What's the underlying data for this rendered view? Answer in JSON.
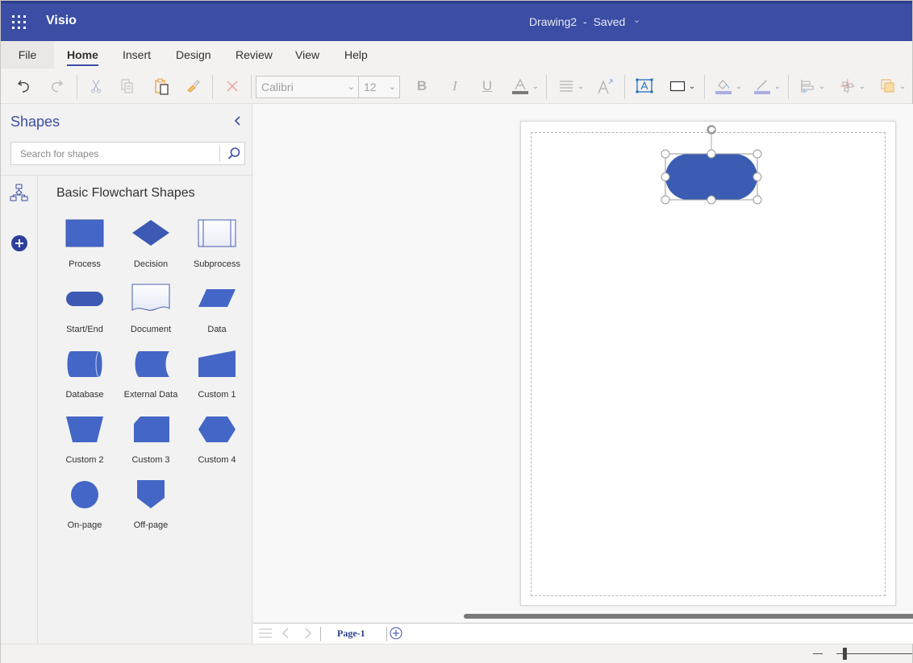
{
  "titlebar": {
    "app_name": "Visio",
    "document_title": "Drawing2",
    "separator": "-",
    "save_status": "Saved",
    "brand_color": "#3b4da4"
  },
  "tabs": [
    {
      "label": "File"
    },
    {
      "label": "Home",
      "active": true
    },
    {
      "label": "Insert"
    },
    {
      "label": "Design"
    },
    {
      "label": "Review"
    },
    {
      "label": "View"
    },
    {
      "label": "Help"
    }
  ],
  "toolbar": {
    "font_name": "Calibri",
    "font_size": "12",
    "icons": [
      "undo-icon",
      "redo-icon",
      "cut-icon",
      "copy-icon",
      "paste-icon",
      "format-painter-icon",
      "delete-icon",
      "bold-icon",
      "italic-icon",
      "underline-icon",
      "font-color-icon",
      "align-icon",
      "font-size-increase-icon",
      "text-box-icon",
      "shape-style-icon",
      "fill-icon",
      "line-color-icon",
      "position-icon",
      "arrange-icon",
      "layers-icon"
    ]
  },
  "shapes_panel": {
    "title": "Shapes",
    "search_placeholder": "Search for shapes",
    "stencil_title": "Basic Flowchart Shapes",
    "shapes": [
      {
        "label": "Process"
      },
      {
        "label": "Decision"
      },
      {
        "label": "Subprocess"
      },
      {
        "label": "Start/End"
      },
      {
        "label": "Document"
      },
      {
        "label": "Data"
      },
      {
        "label": "Database"
      },
      {
        "label": "External Data"
      },
      {
        "label": "Custom 1"
      },
      {
        "label": "Custom 2"
      },
      {
        "label": "Custom 3"
      },
      {
        "label": "Custom 4"
      },
      {
        "label": "On-page"
      },
      {
        "label": "Off-page"
      }
    ],
    "shape_color": "#4466c6"
  },
  "canvas": {
    "selected_shape": "Start/End",
    "shape_fill": "#3a5db3"
  },
  "page_tabs": {
    "pages": [
      {
        "label": "Page-1",
        "active": true
      }
    ]
  }
}
